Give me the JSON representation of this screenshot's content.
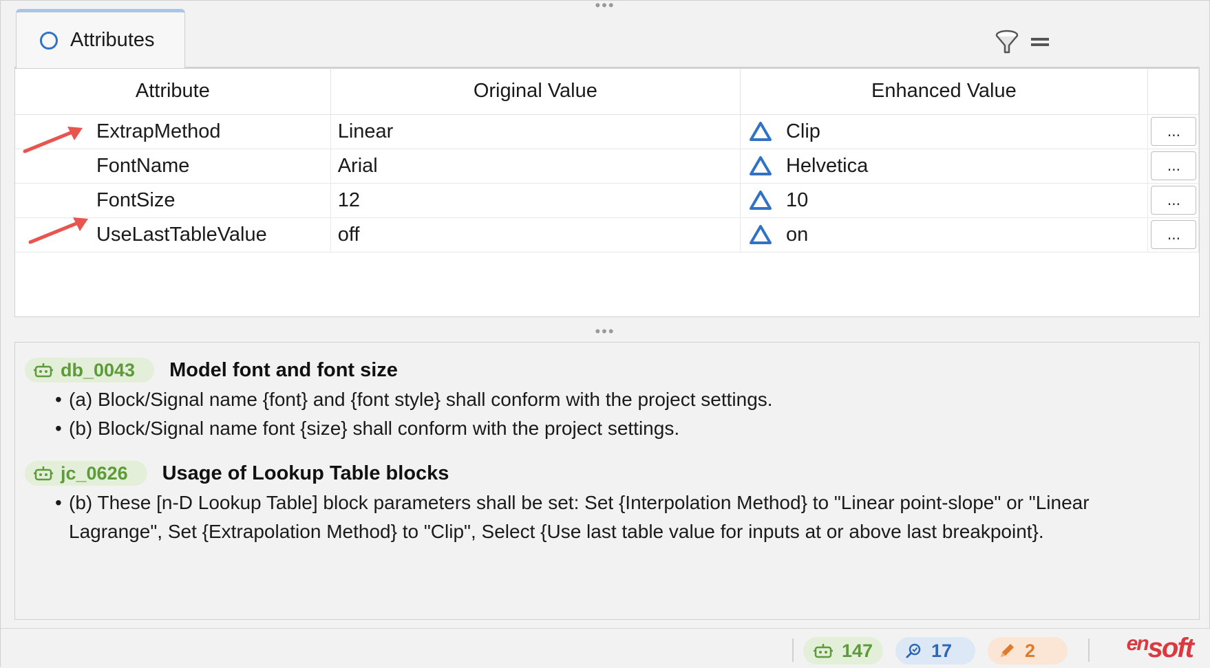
{
  "tab": {
    "label": "Attributes"
  },
  "table": {
    "headers": [
      "Attribute",
      "Original Value",
      "Enhanced Value"
    ],
    "rows": [
      {
        "attribute": "ExtrapMethod",
        "original": "Linear",
        "enhanced": "Clip",
        "button": "..."
      },
      {
        "attribute": "FontName",
        "original": "Arial",
        "enhanced": "Helvetica",
        "button": "..."
      },
      {
        "attribute": "FontSize",
        "original": "12",
        "enhanced": "10",
        "button": "..."
      },
      {
        "attribute": "UseLastTableValue",
        "original": "off",
        "enhanced": "on",
        "button": "..."
      }
    ]
  },
  "rules": [
    {
      "id": "db_0043",
      "title": "Model font and font size",
      "items": [
        "(a) Block/Signal name {font} and {font style} shall conform with the project settings.",
        "(b) Block/Signal name font {size} shall conform with the project settings."
      ]
    },
    {
      "id": "jc_0626",
      "title": "Usage of Lookup Table blocks",
      "items": [
        "(b) These [n-D Lookup Table] block parameters shall be set: Set {Interpolation Method} to \"Linear point-slope\" or \"Linear Lagrange\", Set {Extrapolation Method} to \"Clip\", Select {Use last table value for inputs at or above last breakpoint}."
      ]
    }
  ],
  "status": {
    "guidelines_count": "147",
    "checks_count": "17",
    "edits_count": "2",
    "logo_prefix": "en",
    "logo_suffix": "soft"
  },
  "colors": {
    "accent_blue": "#2f72c6",
    "green": "#5c9a3a",
    "orange": "#e07a2c",
    "arrow_red": "#e8554e",
    "logo_red": "#d9393f"
  }
}
